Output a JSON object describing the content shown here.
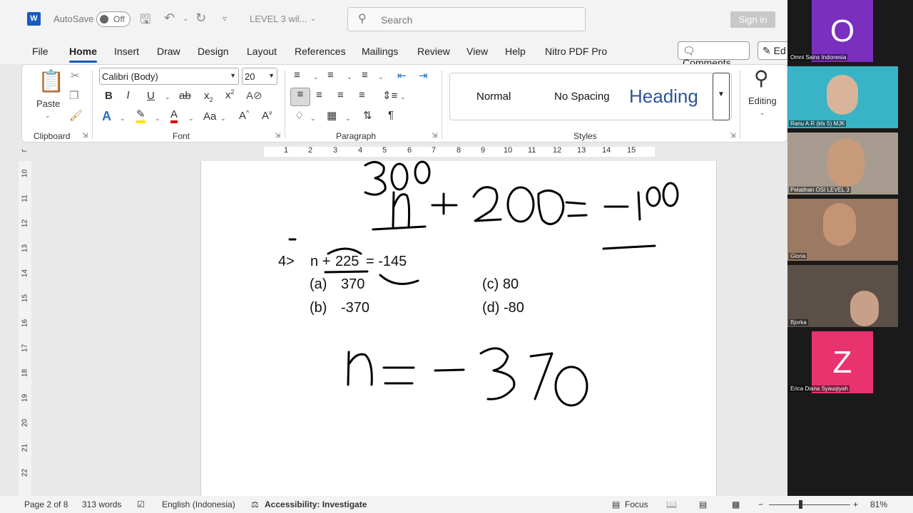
{
  "titlebar": {
    "autosave_label": "AutoSave",
    "autosave_state": "Off",
    "doc_title": "LEVEL 3 wil...",
    "search_placeholder": "Search",
    "signin_label": "Sign in"
  },
  "menu": {
    "tabs": [
      "File",
      "Home",
      "Insert",
      "Draw",
      "Design",
      "Layout",
      "References",
      "Mailings",
      "Review",
      "View",
      "Help",
      "Nitro PDF Pro"
    ],
    "active_tab": "Home",
    "comments_label": "Comments",
    "editing_button_label": "Ed"
  },
  "ribbon": {
    "clipboard": {
      "paste_label": "Paste",
      "group_label": "Clipboard"
    },
    "font": {
      "font_name": "Calibri (Body)",
      "font_size": "20",
      "group_label": "Font",
      "case_button": "Aa"
    },
    "paragraph": {
      "group_label": "Paragraph"
    },
    "styles": {
      "items": [
        "Normal",
        "No Spacing",
        "Heading"
      ],
      "group_label": "Styles"
    },
    "editing": {
      "label": "Editing"
    }
  },
  "ruler": {
    "ticks": [
      "1",
      "2",
      "3",
      "4",
      "5",
      "6",
      "7",
      "8",
      "9",
      "10",
      "11",
      "12",
      "13",
      "14",
      "15"
    ],
    "vticks": [
      "10",
      "11",
      "12",
      "13",
      "14",
      "15",
      "16",
      "17",
      "18",
      "19",
      "20",
      "21",
      "22"
    ]
  },
  "document": {
    "question_number": "4>",
    "equation_left": "n +",
    "equation_num": "225",
    "equation_right": "= -145",
    "option_a_label": "(a)",
    "option_a_value": "370",
    "option_b_label": "(b)",
    "option_b_value": "-370",
    "option_c": "(c) 80",
    "option_d": "(d) -80",
    "handwritten": {
      "line1": "n + 200 = -100",
      "line1_over": "300",
      "line2": "n = -370"
    }
  },
  "status": {
    "page": "Page 2 of 8",
    "words": "313 words",
    "language": "English (Indonesia)",
    "accessibility": "Accessibility: Investigate",
    "focus": "Focus",
    "zoom": "81%"
  },
  "participants": [
    {
      "name": "Omni Sains Indonesia",
      "initial": "O",
      "color": "#7b2fbe"
    },
    {
      "name": "Ranu A.R (kls 5) MJK",
      "initial": "",
      "color": "#39b3c6"
    },
    {
      "name": "Pelatihan OSI LEVEL 3",
      "initial": "",
      "color": "#a79b8f"
    },
    {
      "name": "Gloria",
      "initial": "",
      "color": "#9a7a63"
    },
    {
      "name": "Bjorka",
      "initial": "",
      "color": "#5b5048"
    },
    {
      "name": "Erica Diana Syauqiyah",
      "initial": "Z",
      "color": "#e8336e"
    }
  ]
}
